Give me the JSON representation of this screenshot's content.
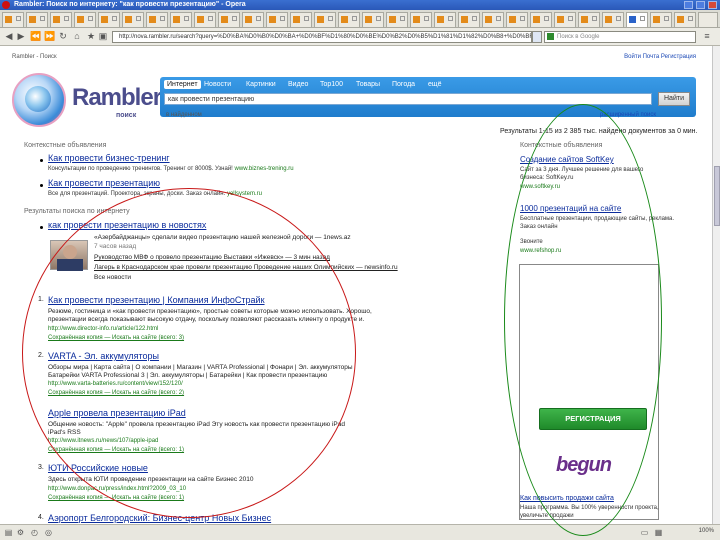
{
  "window": {
    "title": "Rambler: Поиск по интернету: \"как провести презентацию\" - Opera"
  },
  "address": {
    "url": "http://nova.rambler.ru/search?query=%D0%BA%D0%B0%D0%BA+%D0%BF%D1%80%D0%BE%D0%B2%D0%B5%D1%81%D1%82%D0%B8+%D0%BF%D1%80%D0%B5%D0%B7%D0%B5%D0%BD%D1%82%D0%B0%D1%86%D0%B8%D1%8E",
    "search_placeholder": "Поиск в Google"
  },
  "header": {
    "topline": "Rambler - Поиск",
    "toplinks": "Войти  Почта  Регистрация"
  },
  "logo": {
    "word": "Rambler",
    "sub": "поиск"
  },
  "search_tabs": [
    "Интернет",
    "Новости",
    "Картинки",
    "Видео",
    "Top100",
    "Товары",
    "Погода",
    "ещё"
  ],
  "search": {
    "query": "как провести презентацию",
    "button": "Найти",
    "option_left": "в найденном",
    "option_right": "расширенный поиск"
  },
  "found": "Результаты 1-15 из 2 385 тыс. найдено документов за 0 мин.",
  "ads_left": {
    "header": "Контекстные объявления",
    "items": [
      {
        "title": "Как провести бизнес-тренинг",
        "text": "Консультации по проведению тренингов. Тренинг от 8000$. Узнай!",
        "url": "www.biznes-trening.ru"
      },
      {
        "title": "Как провести презентацию",
        "text": "Все для презентаций. Проектора, экраны, доски. Заказ онлайн.",
        "url": "yellsystem.ru"
      }
    ]
  },
  "results_header": "Результаты поиска по интернету",
  "news": {
    "title": "как провести презентацию в новостях",
    "line1": "«Азербайджанцы» сделали видео презентацию нашей железной дороги — 1news.az",
    "line1_sub": "7 часов назад",
    "line2": "Руководство МВФ о провело презентацию Выставки «Ижевск» — 3 мин назад",
    "line3": "Лагерь в Краснодарском крае провели презентацию Проведение наших Олимпийских — newsinfo.ru",
    "more": "Все новости"
  },
  "results": [
    {
      "num": "1.",
      "title": "Как провести презентацию | Компания ИнфоСтрайк",
      "text1": "Резюме, гостиница и «как провести презентацию», простые советы которые можно использовать. Хорошо,",
      "text2": "презентации всегда показывают высокую отдачу, поскольку позволяют рассказать клиенту о продукте и.",
      "url": "http://www.director-info.ru/article/122.html",
      "links": "Сохранённая копия — Искать на сайте (всего: 3)"
    },
    {
      "num": "2.",
      "title": "VARTA - Эл. аккумуляторы",
      "text1": "Обзоры мира | Карта сайта | О компании | Магазин | VARTA Professional | Фонари | Эл. аккумуляторы",
      "text2": "Батарейки VARTA Professional 3 | Эл. аккумуляторы | Батарейки | Как провести презентацию",
      "url": "http://www.varta-batteries.ru/content/view/152/120/",
      "links": "Сохранённая копия — Искать на сайте (всего: 2)"
    },
    {
      "num": "",
      "title": "Apple провела презентацию iPad",
      "text1": "Общение новость: \"Apple\" провела презентацию iPad Эту новость как провести презентацию iPad",
      "text2": "iPad's RSS",
      "url": "http://www.itnews.ru/news/107/apple-ipad",
      "links": "Сохранённая копия — Искать на сайте (всего: 1)"
    },
    {
      "num": "3.",
      "title": "ЮТИ Российские новые",
      "text1": "Здесь открыта ЮТИ проведение презентации на сайте Бизнес 2010",
      "text2": "",
      "url": "http://www.donpac.ru/press/index.html?2009_03_10",
      "links": "Сохранённая копия — Искать на сайте (всего: 1)"
    },
    {
      "num": "4.",
      "title": "Аэропорт Белгородский: Бизнес-центр Новых Бизнес",
      "text1": "",
      "text2": "",
      "url": "",
      "links": ""
    }
  ],
  "ads_right": {
    "header": "Контекстные объявления",
    "items": [
      {
        "title": "Создание сайтов SoftKey",
        "text1": "Сайт за 3 дня. Лучшее решение для вашего",
        "text2": "бизнеса: SoftKey.ru",
        "url": "www.softkey.ru"
      },
      {
        "title": "1000 презентаций на сайте",
        "text1": "Бесплатные презентации, продающие сайты, реклама.",
        "text2": "Заказ онлайн",
        "url": "www.mysite.ru"
      }
    ],
    "call": "Звоните",
    "call_url": "www.refshop.ru",
    "reg_button": "РЕГИСТРАЦИЯ",
    "begun": "begun",
    "footer_title": "Как повысить продажи сайта",
    "footer_text1": "Наша программа. Вы 100% уверенности проекта,",
    "footer_text2": "увеличьте продажи"
  },
  "status": {
    "zoom": "100%"
  },
  "colors": {
    "accent": "#1f7ccc",
    "title_bar": "#2a58b8",
    "annotation_red": "#c81818",
    "annotation_green": "#1a8a1a"
  }
}
